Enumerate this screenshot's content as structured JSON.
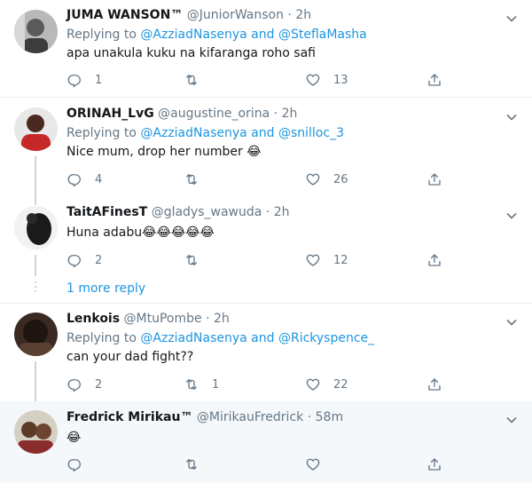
{
  "tweets": [
    {
      "name": "JUMA WANSON™",
      "handle": "@JuniorWanson",
      "time": "2h",
      "replying_prefix": "Replying to",
      "replying_to_1": "@AzziadNasenya",
      "replying_and": "and",
      "replying_to_2": "@SteflaMasha",
      "text": "apa unakula kuku na kifaranga roho safi",
      "replies": "1",
      "retweets": "",
      "likes": "13"
    },
    {
      "name": "ORINAH_LvG",
      "handle": "@augustine_orina",
      "time": "2h",
      "replying_prefix": "Replying to",
      "replying_to_1": "@AzziadNasenya",
      "replying_and": "and",
      "replying_to_2": "@snilloc_3",
      "text": "Nice mum, drop her number 😂",
      "replies": "4",
      "retweets": "",
      "likes": "26"
    },
    {
      "name": "TaitAFinesT",
      "handle": "@gladys_wawuda",
      "time": "2h",
      "text": "Huna adabu😂😂😂😂😂",
      "replies": "2",
      "retweets": "",
      "likes": "12"
    },
    {
      "name": "Lenkois",
      "handle": "@MtuPombe",
      "time": "2h",
      "replying_prefix": "Replying to",
      "replying_to_1": "@AzziadNasenya",
      "replying_and": "and",
      "replying_to_2": "@Rickyspence_",
      "text": "can your dad fight??",
      "replies": "2",
      "retweets": "1",
      "likes": "22"
    },
    {
      "name": "Fredrick Mirikau™",
      "handle": "@MirikauFredrick",
      "time": "58m",
      "text": "😂",
      "replies": "",
      "retweets": "",
      "likes": ""
    }
  ],
  "more_replies": "1 more reply",
  "separator": "·",
  "icons": {
    "reply": "reply-icon",
    "retweet": "retweet-icon",
    "like": "heart-icon",
    "share": "share-icon",
    "more": "chevron-down-icon"
  },
  "colors": {
    "link": "#1b95e0",
    "muted": "#657786",
    "highlight_bg": "#f5f8fa"
  }
}
